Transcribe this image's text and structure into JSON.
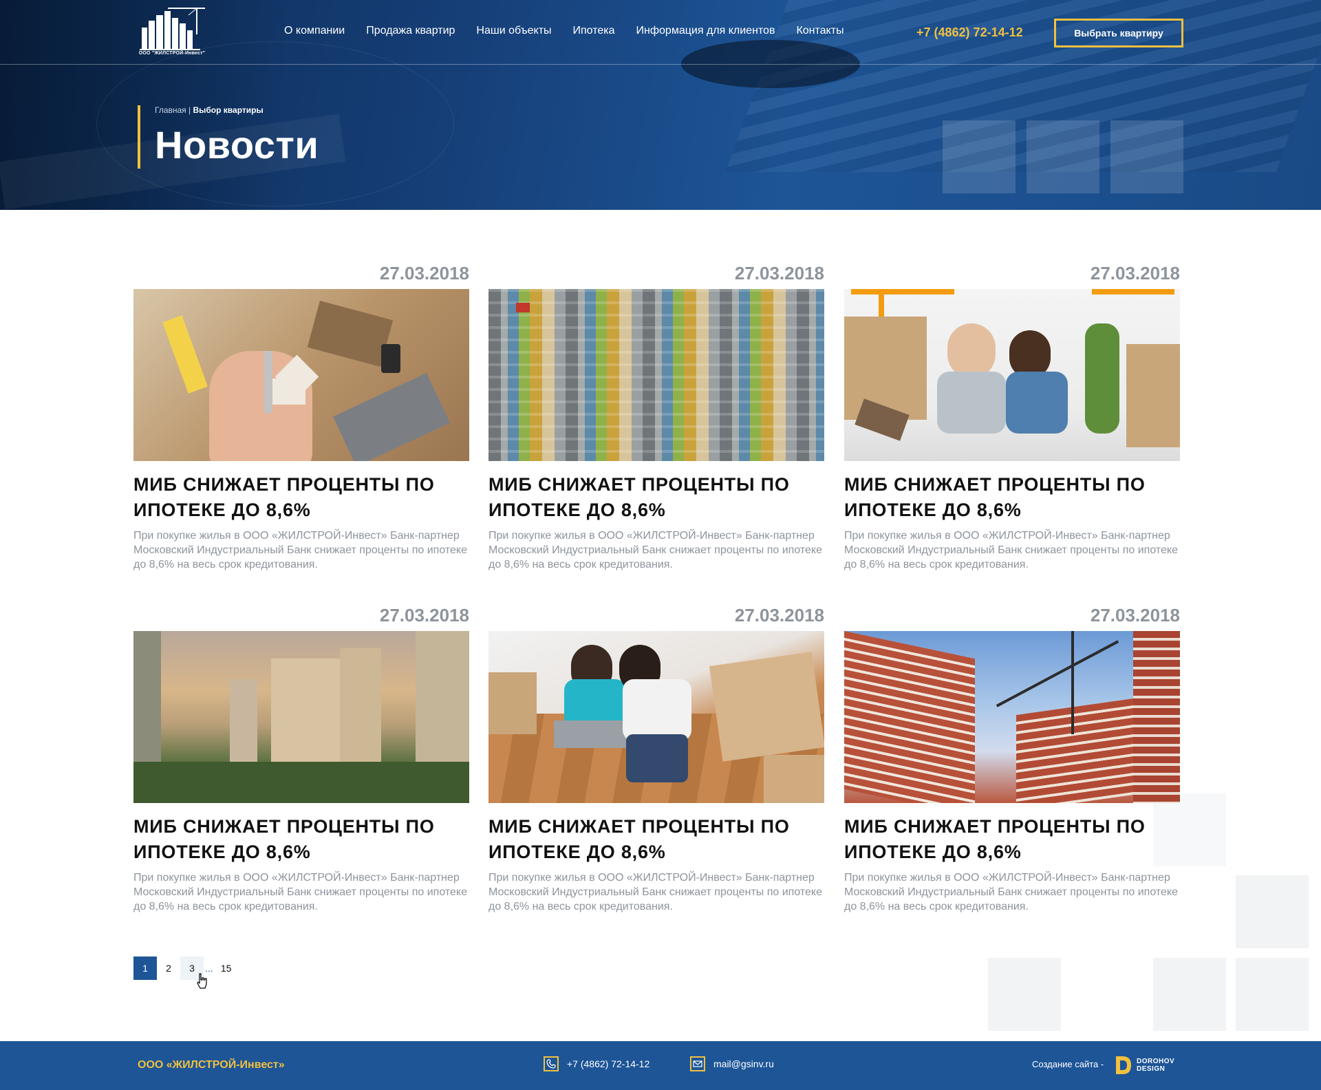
{
  "header": {
    "logo_text": "ООО \"ЖИЛСТРОЙ-Инвест\"",
    "nav": [
      "О компании",
      "Продажа квартир",
      "Наши объекты",
      "Ипотека",
      "Информация для клиентов",
      "Контакты"
    ],
    "phone": "+7 (4862) 72-14-12",
    "cta_label": "Выбрать квартиру"
  },
  "hero": {
    "breadcrumb_home": "Главная",
    "breadcrumb_sep": " | ",
    "breadcrumb_current": "Выбор квартиры",
    "title": "Новости"
  },
  "news": [
    {
      "date": "27.03.2018",
      "title": "МИБ снижает проценты по ипотеке до 8,6%",
      "text": "При покупке жилья в ООО «ЖИЛСТРОЙ-Инвест» Банк-партнер Московский Индустриальный Банк снижает проценты по ипотеке до 8,6% на весь срок кредитования."
    },
    {
      "date": "27.03.2018",
      "title": "МИБ снижает проценты по ипотеке до 8,6%",
      "text": "При покупке жилья в ООО «ЖИЛСТРОЙ-Инвест» Банк-партнер Московский Индустриальный Банк снижает проценты по ипотеке до 8,6% на весь срок кредитования."
    },
    {
      "date": "27.03.2018",
      "title": "МИБ снижает проценты по ипотеке до 8,6%",
      "text": "При покупке жилья в ООО «ЖИЛСТРОЙ-Инвест» Банк-партнер Московский Индустриальный Банк снижает проценты по ипотеке до 8,6% на весь срок кредитования."
    },
    {
      "date": "27.03.2018",
      "title": "МИБ снижает проценты по ипотеке до 8,6%",
      "text": "При покупке жилья в ООО «ЖИЛСТРОЙ-Инвест» Банк-партнер Московский Индустриальный Банк снижает проценты по ипотеке до 8,6% на весь срок кредитования."
    },
    {
      "date": "27.03.2018",
      "title": "МИБ снижает проценты по ипотеке до 8,6%",
      "text": "При покупке жилья в ООО «ЖИЛСТРОЙ-Инвест» Банк-партнер Московский Индустриальный Банк снижает проценты по ипотеке до 8,6% на весь срок кредитования."
    },
    {
      "date": "27.03.2018",
      "title": "МИБ снижает проценты по ипотеке до 8,6%",
      "text": "При покупке жилья в ООО «ЖИЛСТРОЙ-Инвест» Банк-партнер Московский Индустриальный Банк снижает проценты по ипотеке до 8,6% на весь срок кредитования."
    }
  ],
  "pagination": {
    "pages": [
      "1",
      "2",
      "3"
    ],
    "dots": "...",
    "last": "15",
    "active": "1"
  },
  "footer": {
    "company": "ООО «ЖИЛСТРОЙ-Инвест»",
    "phone": "+7 (4862) 72-14-12",
    "email": "mail@gsinv.ru",
    "credit": "Создание сайта -",
    "brand_line1": "DOROHOV",
    "brand_line2": "DESIGN"
  },
  "colors": {
    "accent": "#f0c040",
    "primary": "#1d5597",
    "muted_text": "#8d949c"
  },
  "icons": [
    "phone-icon",
    "mail-icon",
    "cursor-hand-icon"
  ]
}
